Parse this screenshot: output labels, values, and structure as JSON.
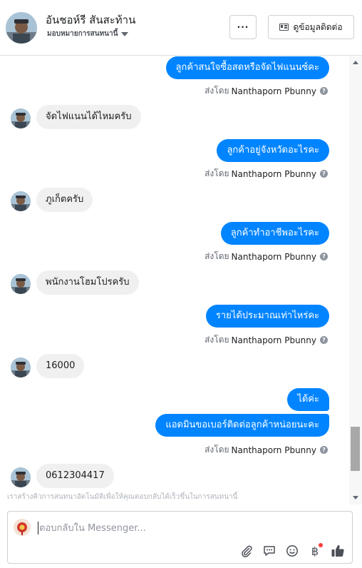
{
  "header": {
    "name": "อันชอห์รี สันสะท้าน",
    "assign_label": "มอบหมายการสนทนานี้",
    "more_label": "···",
    "info_button": "ดูข้อมูลติดต่อ"
  },
  "sent_by_label": "ส่งโดย",
  "messages": [
    {
      "dir": "out",
      "text": "ลูกค้าสนใจซื้อสดหรือจัดไฟแนนซ์คะ",
      "sender": "Nanthaporn Pbunny"
    },
    {
      "dir": "in",
      "text": "จัดไฟแนนได้ไหมครับ"
    },
    {
      "dir": "out",
      "text": "ลูกค้าอยู่จังหวัดอะไรคะ",
      "sender": "Nanthaporn Pbunny"
    },
    {
      "dir": "in",
      "text": "ภูเก็ตครับ"
    },
    {
      "dir": "out",
      "text": "ลูกค้าทำอาชีพอะไรคะ",
      "sender": "Nanthaporn Pbunny"
    },
    {
      "dir": "in",
      "text": "พนักงานโฮมโปรครับ"
    },
    {
      "dir": "out",
      "text": "รายได้ประมาณเท่าไหร่คะ",
      "sender": "Nanthaporn Pbunny"
    },
    {
      "dir": "in",
      "text": "16000"
    },
    {
      "dir": "out",
      "text": "ได้ค่ะ"
    },
    {
      "dir": "out",
      "text": "แอดมินขอเบอร์ติดต่อลูกค้าหน่อยนะคะ",
      "sender": "Nanthaporn Pbunny"
    },
    {
      "dir": "in",
      "text": "0612304417"
    }
  ],
  "faded_notice": "เราสร้างคิวการสนทนาอัตโนมัติเพื่อให้คุณตอบกลับได้เร็วขึ้นในการสนทนานี้",
  "composer": {
    "placeholder": "ตอบกลับใน Messenger..."
  },
  "icons": {
    "attach": "paperclip-icon",
    "saved_replies": "chat-bubble-icon",
    "emoji": "smiley-icon",
    "payment": "baht-icon",
    "like": "thumbs-up-icon",
    "help": "question-icon"
  },
  "colors": {
    "accent": "#0084ff",
    "incoming_bubble": "#f1f0f0",
    "notification": "#fa3e3e"
  }
}
